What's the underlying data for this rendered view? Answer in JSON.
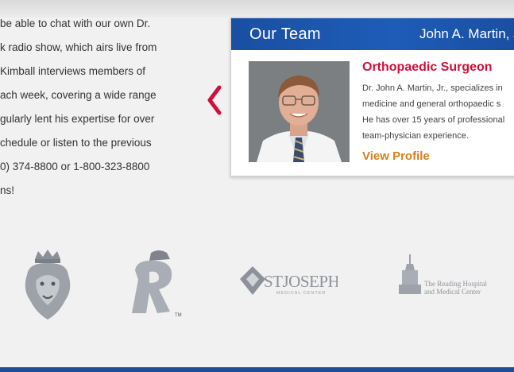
{
  "story": {
    "lines": [
      "be able to chat with our own Dr.",
      "k radio show, which airs live from",
      " Kimball interviews members of",
      "ach week, covering a wide range",
      "gularly lent his expertise for over",
      "chedule or listen to the previous",
      "0) 374-8800 or 1-800-323-8800",
      "ns!"
    ]
  },
  "team": {
    "title": "Our Team",
    "name": "John A. Martin, J",
    "role": "Orthopaedic Surgeon",
    "bio_lines": [
      "Dr. John A. Martin, Jr., specializes in",
      "medicine and general orthopaedic s",
      "He has over 15 years of professional",
      "team-physician experience."
    ],
    "view_profile": "View Profile"
  },
  "sponsors": {
    "stjoseph_main": "STJOSEPH",
    "stjoseph_sub": "MEDICAL CENTER",
    "reading_line1": "The Reading Hospital",
    "reading_line2": "and Medical Center",
    "royals_tm": "TM"
  },
  "colors": {
    "header_blue": "#1e5cb8",
    "role_red": "#d0103a",
    "link_orange": "#d67f1a",
    "arrow_red": "#d0103a"
  }
}
